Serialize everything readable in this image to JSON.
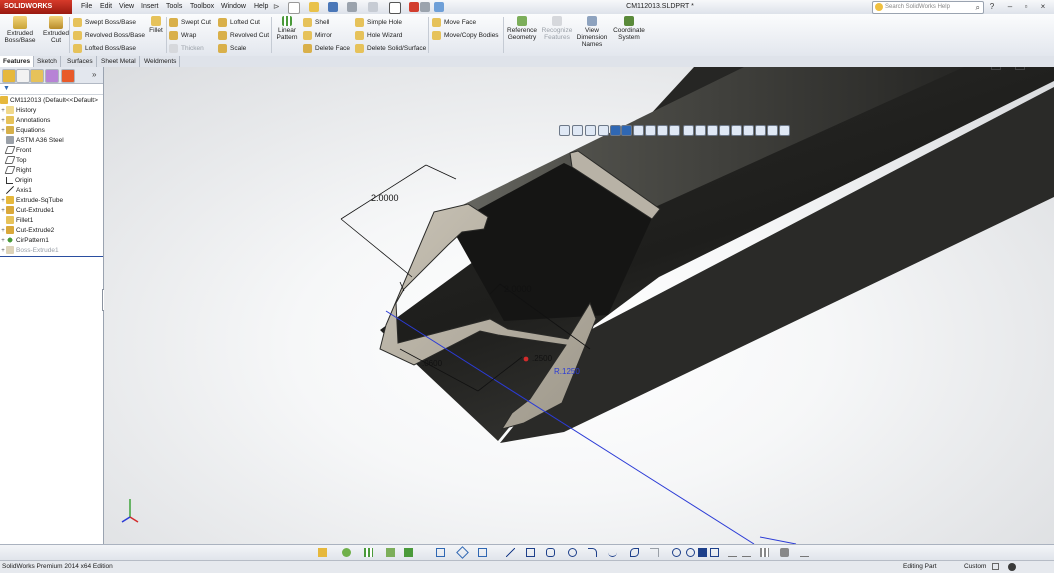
{
  "app": {
    "logo_text": "SOLIDWORKS",
    "doc_title": "CM112013.SLDPRT *"
  },
  "menu": [
    "File",
    "Edit",
    "View",
    "Insert",
    "Tools",
    "Toolbox",
    "Window",
    "Help"
  ],
  "search": {
    "placeholder": "Search SolidWorks Help"
  },
  "commands": {
    "extruded_boss": "Extruded Boss/Base",
    "extruded_cut": "Extruded Cut",
    "swept_boss": "Swept Boss/Base",
    "revolved_boss": "Revolved Boss/Base",
    "lofted_boss": "Lofted Boss/Base",
    "fillet": "Fillet",
    "swept_cut": "Swept Cut",
    "wrap": "Wrap",
    "thicken": "Thicken",
    "lofted_cut": "Lofted Cut",
    "revolved_cut": "Revolved Cut",
    "scale": "Scale",
    "linear_pattern": "Linear Pattern",
    "shell": "Shell",
    "mirror": "Mirror",
    "delete_face": "Delete Face",
    "simple_hole": "Simple Hole",
    "hole_wizard": "Hole Wizard",
    "delete_solid": "Delete Solid/Surface",
    "move_face": "Move Face",
    "move_copy_bodies": "Move/Copy Bodies",
    "reference_geometry": "Reference Geometry",
    "recognize_features": "Recognize Features",
    "view_dimension_names": "View Dimension Names",
    "coordinate_system": "Coordinate System"
  },
  "tabs": [
    "Features",
    "Sketch",
    "Surfaces",
    "Sheet Metal",
    "Weldments"
  ],
  "tree": {
    "root": "CM112013  (Default<<Default>",
    "items": [
      "History",
      "Annotations",
      "Equations",
      "ASTM A36 Steel",
      "Front",
      "Top",
      "Right",
      "Origin",
      "Axis1",
      "Extrude-SqTube",
      "Cut-Extrude1",
      "Fillet1",
      "Cut-Extrude2",
      "CirPattern1",
      "Boss-Extrude1"
    ]
  },
  "dimensions": {
    "d1": "2.0000",
    "d2": "2.0000",
    "d3": ".0600",
    "d4": ".2500",
    "d5": "R.1250"
  },
  "status": {
    "edition": "SolidWorks Premium 2014 x64 Edition",
    "mode": "Editing Part",
    "units": "Custom"
  },
  "colors": {
    "logo_red": "#c0281c",
    "selection_blue": "#2f67b3",
    "model_dark": "#3a3a37",
    "model_face": "#b8b2a6"
  }
}
